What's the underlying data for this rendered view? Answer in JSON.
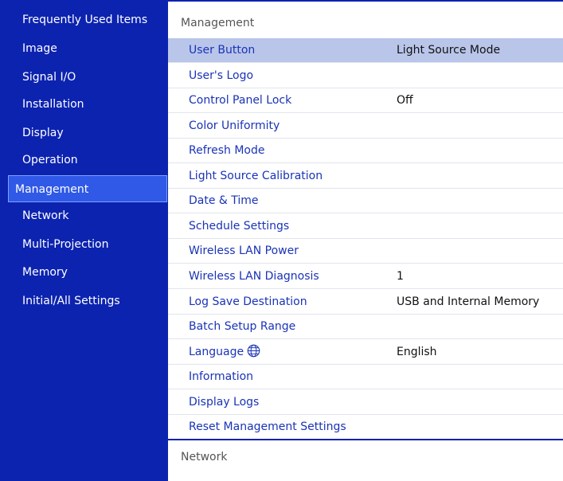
{
  "sidebar": {
    "items": [
      {
        "label": "Frequently Used Items"
      },
      {
        "label": "Image"
      },
      {
        "label": "Signal I/O"
      },
      {
        "label": "Installation"
      },
      {
        "label": "Display"
      },
      {
        "label": "Operation"
      },
      {
        "label": "Management"
      },
      {
        "label": "Network"
      },
      {
        "label": "Multi-Projection"
      },
      {
        "label": "Memory"
      },
      {
        "label": "Initial/All Settings"
      }
    ],
    "selected": "Management"
  },
  "main": {
    "section_title": "Management",
    "rows": [
      {
        "label": "User Button",
        "value": "Light Source Mode"
      },
      {
        "label": "User's Logo",
        "value": ""
      },
      {
        "label": "Control Panel Lock",
        "value": "Off"
      },
      {
        "label": "Color Uniformity",
        "value": ""
      },
      {
        "label": "Refresh Mode",
        "value": ""
      },
      {
        "label": "Light Source Calibration",
        "value": ""
      },
      {
        "label": "Date & Time",
        "value": ""
      },
      {
        "label": "Schedule Settings",
        "value": ""
      },
      {
        "label": "Wireless LAN Power",
        "value": ""
      },
      {
        "label": "Wireless LAN Diagnosis",
        "value": "1"
      },
      {
        "label": "Log Save Destination",
        "value": "USB and Internal Memory"
      },
      {
        "label": "Batch Setup Range",
        "value": ""
      },
      {
        "label": "Language",
        "value": "English",
        "icon": "globe-icon"
      },
      {
        "label": "Information",
        "value": ""
      },
      {
        "label": "Display Logs",
        "value": ""
      },
      {
        "label": "Reset Management Settings",
        "value": ""
      }
    ],
    "selected_row": "User Button",
    "next_section_title": "Network"
  },
  "colors": {
    "sidebar_bg": "#0c23b0",
    "sidebar_selected": "#2f59e6",
    "row_text": "#1a33b6",
    "row_selected_bg": "#b9c6ea"
  }
}
